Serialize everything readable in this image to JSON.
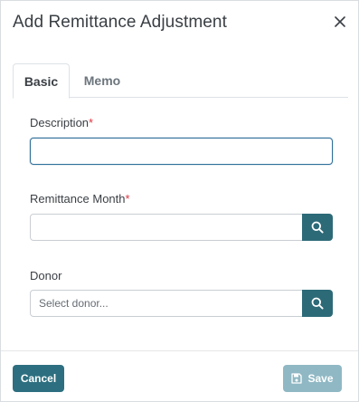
{
  "dialog": {
    "title": "Add Remittance Adjustment",
    "close_icon": "close-icon"
  },
  "tabs": [
    {
      "label": "Basic",
      "active": true
    },
    {
      "label": "Memo",
      "active": false
    }
  ],
  "fields": {
    "description": {
      "label": "Description",
      "required_mark": "*",
      "value": "",
      "placeholder": ""
    },
    "remittance_month": {
      "label": "Remittance Month",
      "required_mark": "*",
      "value": "",
      "placeholder": "",
      "button_icon": "search-icon"
    },
    "donor": {
      "label": "Donor",
      "value": "",
      "placeholder": "Select donor...",
      "button_icon": "search-icon"
    }
  },
  "footer": {
    "cancel_label": "Cancel",
    "save_label": "Save",
    "save_icon": "floppy-disk-icon"
  },
  "colors": {
    "primary": "#2d6a78",
    "disabled_primary": "#8fb8c4",
    "required": "#dc3545"
  }
}
